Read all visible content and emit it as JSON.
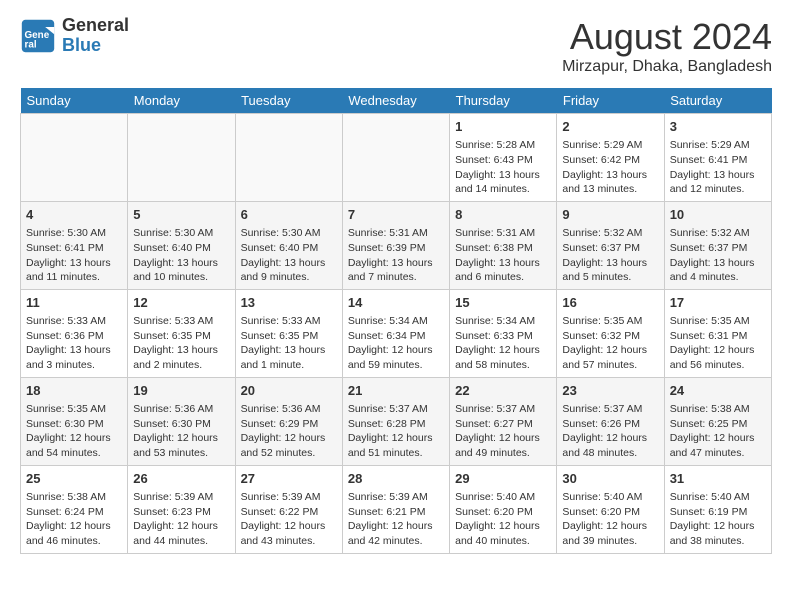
{
  "logo": {
    "line1": "General",
    "line2": "Blue"
  },
  "title": "August 2024",
  "subtitle": "Mirzapur, Dhaka, Bangladesh",
  "days_of_week": [
    "Sunday",
    "Monday",
    "Tuesday",
    "Wednesday",
    "Thursday",
    "Friday",
    "Saturday"
  ],
  "weeks": [
    [
      {
        "day": "",
        "info": ""
      },
      {
        "day": "",
        "info": ""
      },
      {
        "day": "",
        "info": ""
      },
      {
        "day": "",
        "info": ""
      },
      {
        "day": "1",
        "info": "Sunrise: 5:28 AM\nSunset: 6:43 PM\nDaylight: 13 hours\nand 14 minutes."
      },
      {
        "day": "2",
        "info": "Sunrise: 5:29 AM\nSunset: 6:42 PM\nDaylight: 13 hours\nand 13 minutes."
      },
      {
        "day": "3",
        "info": "Sunrise: 5:29 AM\nSunset: 6:41 PM\nDaylight: 13 hours\nand 12 minutes."
      }
    ],
    [
      {
        "day": "4",
        "info": "Sunrise: 5:30 AM\nSunset: 6:41 PM\nDaylight: 13 hours\nand 11 minutes."
      },
      {
        "day": "5",
        "info": "Sunrise: 5:30 AM\nSunset: 6:40 PM\nDaylight: 13 hours\nand 10 minutes."
      },
      {
        "day": "6",
        "info": "Sunrise: 5:30 AM\nSunset: 6:40 PM\nDaylight: 13 hours\nand 9 minutes."
      },
      {
        "day": "7",
        "info": "Sunrise: 5:31 AM\nSunset: 6:39 PM\nDaylight: 13 hours\nand 7 minutes."
      },
      {
        "day": "8",
        "info": "Sunrise: 5:31 AM\nSunset: 6:38 PM\nDaylight: 13 hours\nand 6 minutes."
      },
      {
        "day": "9",
        "info": "Sunrise: 5:32 AM\nSunset: 6:37 PM\nDaylight: 13 hours\nand 5 minutes."
      },
      {
        "day": "10",
        "info": "Sunrise: 5:32 AM\nSunset: 6:37 PM\nDaylight: 13 hours\nand 4 minutes."
      }
    ],
    [
      {
        "day": "11",
        "info": "Sunrise: 5:33 AM\nSunset: 6:36 PM\nDaylight: 13 hours\nand 3 minutes."
      },
      {
        "day": "12",
        "info": "Sunrise: 5:33 AM\nSunset: 6:35 PM\nDaylight: 13 hours\nand 2 minutes."
      },
      {
        "day": "13",
        "info": "Sunrise: 5:33 AM\nSunset: 6:35 PM\nDaylight: 13 hours\nand 1 minute."
      },
      {
        "day": "14",
        "info": "Sunrise: 5:34 AM\nSunset: 6:34 PM\nDaylight: 12 hours\nand 59 minutes."
      },
      {
        "day": "15",
        "info": "Sunrise: 5:34 AM\nSunset: 6:33 PM\nDaylight: 12 hours\nand 58 minutes."
      },
      {
        "day": "16",
        "info": "Sunrise: 5:35 AM\nSunset: 6:32 PM\nDaylight: 12 hours\nand 57 minutes."
      },
      {
        "day": "17",
        "info": "Sunrise: 5:35 AM\nSunset: 6:31 PM\nDaylight: 12 hours\nand 56 minutes."
      }
    ],
    [
      {
        "day": "18",
        "info": "Sunrise: 5:35 AM\nSunset: 6:30 PM\nDaylight: 12 hours\nand 54 minutes."
      },
      {
        "day": "19",
        "info": "Sunrise: 5:36 AM\nSunset: 6:30 PM\nDaylight: 12 hours\nand 53 minutes."
      },
      {
        "day": "20",
        "info": "Sunrise: 5:36 AM\nSunset: 6:29 PM\nDaylight: 12 hours\nand 52 minutes."
      },
      {
        "day": "21",
        "info": "Sunrise: 5:37 AM\nSunset: 6:28 PM\nDaylight: 12 hours\nand 51 minutes."
      },
      {
        "day": "22",
        "info": "Sunrise: 5:37 AM\nSunset: 6:27 PM\nDaylight: 12 hours\nand 49 minutes."
      },
      {
        "day": "23",
        "info": "Sunrise: 5:37 AM\nSunset: 6:26 PM\nDaylight: 12 hours\nand 48 minutes."
      },
      {
        "day": "24",
        "info": "Sunrise: 5:38 AM\nSunset: 6:25 PM\nDaylight: 12 hours\nand 47 minutes."
      }
    ],
    [
      {
        "day": "25",
        "info": "Sunrise: 5:38 AM\nSunset: 6:24 PM\nDaylight: 12 hours\nand 46 minutes."
      },
      {
        "day": "26",
        "info": "Sunrise: 5:39 AM\nSunset: 6:23 PM\nDaylight: 12 hours\nand 44 minutes."
      },
      {
        "day": "27",
        "info": "Sunrise: 5:39 AM\nSunset: 6:22 PM\nDaylight: 12 hours\nand 43 minutes."
      },
      {
        "day": "28",
        "info": "Sunrise: 5:39 AM\nSunset: 6:21 PM\nDaylight: 12 hours\nand 42 minutes."
      },
      {
        "day": "29",
        "info": "Sunrise: 5:40 AM\nSunset: 6:20 PM\nDaylight: 12 hours\nand 40 minutes."
      },
      {
        "day": "30",
        "info": "Sunrise: 5:40 AM\nSunset: 6:20 PM\nDaylight: 12 hours\nand 39 minutes."
      },
      {
        "day": "31",
        "info": "Sunrise: 5:40 AM\nSunset: 6:19 PM\nDaylight: 12 hours\nand 38 minutes."
      }
    ]
  ]
}
